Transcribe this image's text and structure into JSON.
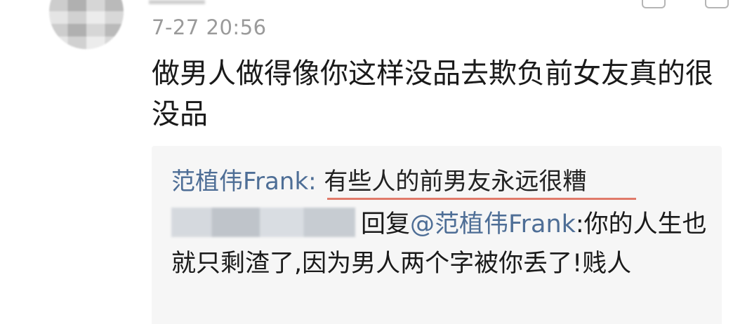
{
  "comment": {
    "timestamp": "7-27 20:56",
    "text": "做男人做得像你这样没品去欺负前女友真的很没品"
  },
  "quoted": {
    "author": "范植伟Frank",
    "separator": ":",
    "text": "有些人的前男友永远很糟"
  },
  "reply": {
    "prefix": "回复",
    "mention": "@范植伟Frank",
    "text": ":你的人生也就只剩渣了,因为男人两个字被你丢了!贱人"
  },
  "colors": {
    "link": "#4e6e96",
    "underline": "#e07a6a",
    "timestamp": "#9a9a9a",
    "reply_background": "#f6f6f6"
  }
}
